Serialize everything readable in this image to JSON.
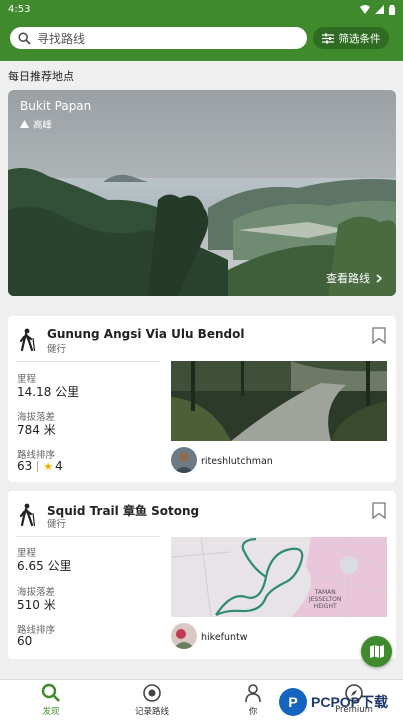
{
  "status_bar": {
    "time": "4:53"
  },
  "search": {
    "placeholder": "寻找路线"
  },
  "filter": {
    "label": "筛选条件"
  },
  "daily": {
    "section_title": "每日推荐地点",
    "place_name": "Bukit Papan",
    "place_type": "高峰",
    "view_route": "查看路线"
  },
  "trails": [
    {
      "name": "Gunung Angsi Via Ulu Bendol",
      "activity": "健行",
      "distance_label": "里程",
      "distance": "14.18 公里",
      "elevation_label": "海拔落差",
      "elevation": "784 米",
      "rank_label": "路线排序",
      "rank": "63",
      "rating": "4",
      "username": "riteshlutchman"
    },
    {
      "name": "Squid Trail 章鱼 Sotong",
      "activity": "健行",
      "distance_label": "里程",
      "distance": "6.65 公里",
      "elevation_label": "海拔落差",
      "elevation": "510 米",
      "rank_label": "路线排序",
      "rank": "60",
      "username": "hikefuntw",
      "map_labels": [
        "TAMAN",
        "JESSELTON",
        "HEIGHT"
      ]
    }
  ],
  "nav": {
    "discover": "发现",
    "record": "记录路线",
    "you": "你",
    "premium": "Premium"
  },
  "watermark": {
    "badge": "P",
    "text": "PCPOP下载"
  },
  "colors": {
    "brand_green": "#3f8a2c",
    "dark_green": "#2f6b22",
    "star": "#f2b300"
  }
}
